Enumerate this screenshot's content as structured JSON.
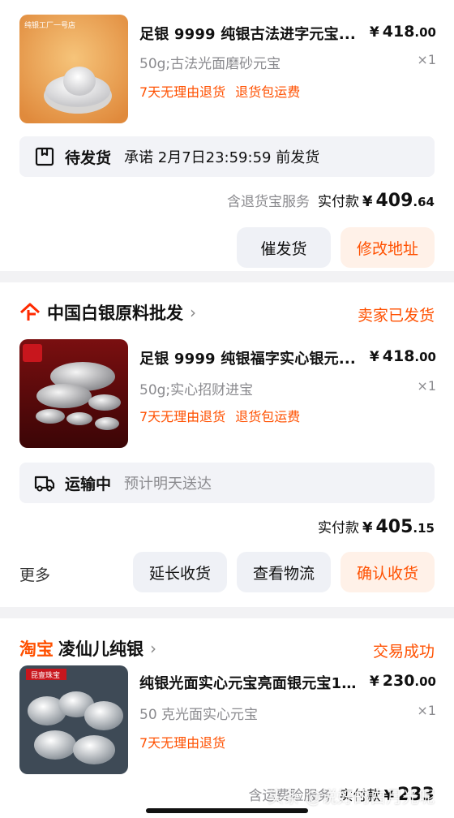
{
  "orders": [
    {
      "product": {
        "thumb_label": "纯银工厂一号店",
        "title": "足银 9999 纯银古法进字元宝...",
        "price_currency": "¥",
        "price_int": "418",
        "price_cents": ".00",
        "spec": "50g;古法光面磨砂元宝",
        "qty": "×1",
        "tags": [
          "7天无理由退货",
          "退货包运费"
        ]
      },
      "status": {
        "main": "待发货",
        "sub": "承诺 2月7日23:59:59 前发货"
      },
      "summary": {
        "service": "含退货宝服务",
        "label": "实付款",
        "currency": "¥",
        "amount_int": "409",
        "amount_cents": ".64"
      },
      "buttons": [
        "催发货",
        "修改地址"
      ]
    },
    {
      "shop": {
        "name": "中国白银原料批发",
        "status": "卖家已发货"
      },
      "product": {
        "title": "足银 9999 纯银福字实心银元...",
        "price_currency": "¥",
        "price_int": "418",
        "price_cents": ".00",
        "spec": "50g;实心招财进宝",
        "qty": "×1",
        "tags": [
          "7天无理由退货",
          "退货包运费"
        ]
      },
      "status": {
        "main": "运输中",
        "sub": "预计明天送达"
      },
      "summary": {
        "label": "实付款",
        "currency": "¥",
        "amount_int": "405",
        "amount_cents": ".15"
      },
      "more": "更多",
      "buttons": [
        "延长收货",
        "查看物流",
        "确认收货"
      ]
    },
    {
      "shop": {
        "platform": "淘宝",
        "name": "凌仙儿纯银",
        "status": "交易成功"
      },
      "product": {
        "thumb_label": "昆壹珠宝",
        "title": "纯银光面实心元宝亮面银元宝1...",
        "price_currency": "¥",
        "price_int": "230",
        "price_cents": ".00",
        "spec": "50 克光面实心元宝",
        "qty": "×1",
        "tags": [
          "7天无理由退货"
        ]
      },
      "summary": {
        "service": "含运费险服务",
        "label": "实付款",
        "currency": "¥",
        "amount_int": "233"
      }
    }
  ],
  "watermark": "头条 @说好的白月光呢",
  "colors": {
    "accent": "#ff5000",
    "muted": "#8b8b8f",
    "panel": "#f2f3f7"
  }
}
